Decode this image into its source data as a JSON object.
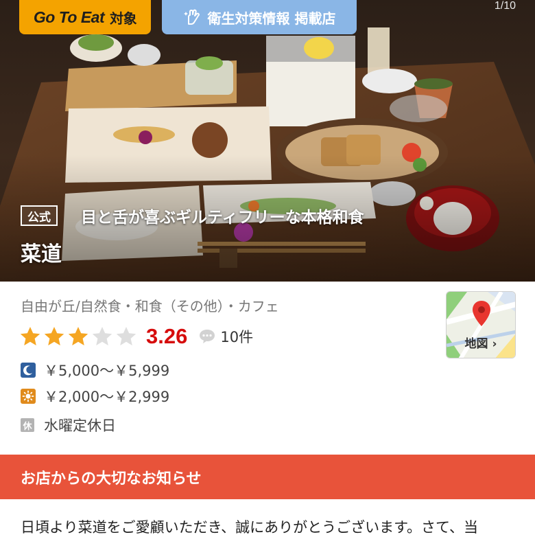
{
  "badges": {
    "gotoeat_main": "Go To Eat",
    "gotoeat_suffix": "対象",
    "hygiene": "衛生対策情報 掲載店"
  },
  "photo": {
    "counter": "1/10"
  },
  "hero": {
    "official_tag": "公式",
    "catchphrase": "目と舌が喜ぶギルティフリーな本格和食",
    "store_name": "菜道"
  },
  "info": {
    "genre": "自由が丘/自然食・和食（その他）・カフェ",
    "rating": {
      "score": "3.26",
      "stars_filled": 3,
      "stars_total": 5,
      "reviews": "10件"
    },
    "dinner_price": "￥5,000～￥5,999",
    "lunch_price": "￥2,000～￥2,999",
    "closed_day_icon": "休",
    "closed_day": "水曜定休日",
    "map_label": "地図 ›"
  },
  "notice": {
    "header": "お店からの大切なお知らせ",
    "body": "日頃より菜道をご愛顧いただき、誠にありがとうございます。さて、当"
  },
  "colors": {
    "gotoeat": "#f4a300",
    "hygiene": "#8ab6e6",
    "score": "#d60c0c",
    "star": "#f5a623",
    "notice": "#e8533a",
    "dinner_icon": "#2f5f9e",
    "lunch_icon": "#e08b1c"
  },
  "icons": {
    "hygiene": "hand-sparkle-icon",
    "review": "speech-bubble-icon",
    "dinner": "moon-icon",
    "lunch": "sun-icon",
    "map": "map-pin-icon"
  }
}
